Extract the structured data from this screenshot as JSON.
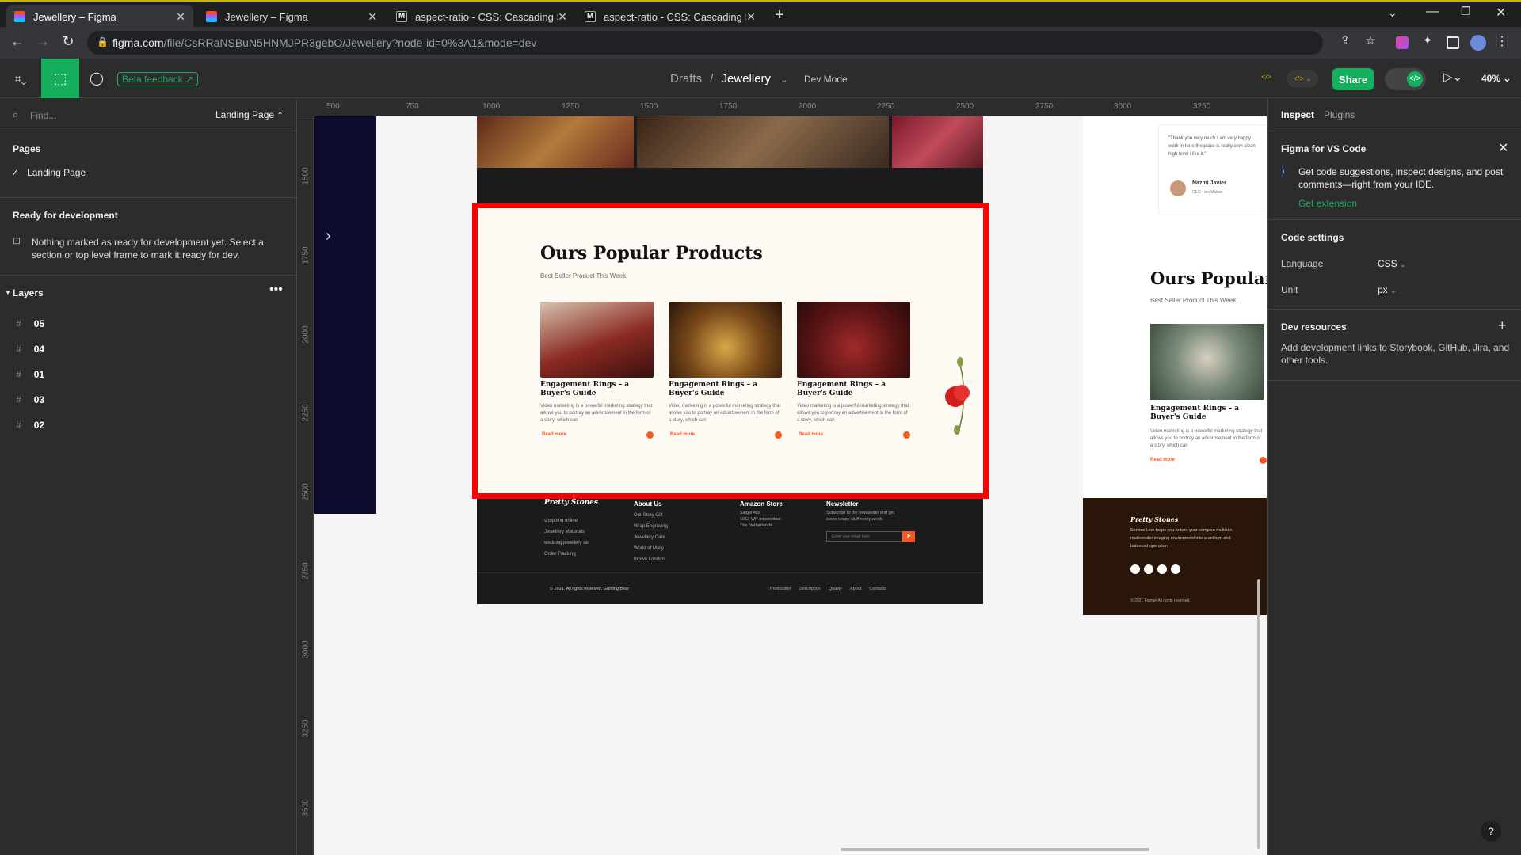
{
  "browser": {
    "tabs": [
      {
        "title": "Jewellery – Figma",
        "icon": "figma-icon"
      },
      {
        "title": "Jewellery – Figma",
        "icon": "figma-icon"
      },
      {
        "title": "aspect-ratio - CSS: Cascading St",
        "icon": "mdn-icon"
      },
      {
        "title": "aspect-ratio - CSS: Cascading St",
        "icon": "mdn-icon"
      }
    ],
    "url_host": "figma.com",
    "url_path": "/file/CsRRaNSBuN5HNMJPR3gebO/Jewellery?node-id=0%3A1&mode=dev"
  },
  "toolbar": {
    "beta_feedback": "Beta feedback",
    "breadcrumb_root": "Drafts",
    "breadcrumb_sep": "/",
    "file_name": "Jewellery",
    "dev_mode": "Dev Mode",
    "share": "Share",
    "zoom": "40%"
  },
  "left_panel": {
    "search_placeholder": "Find...",
    "page_selector": "Landing Page",
    "pages_heading": "Pages",
    "pages": [
      "Landing Page"
    ],
    "ready_heading": "Ready for development",
    "ready_text": "Nothing marked as ready for development yet. Select a section or top level frame to mark it ready for dev.",
    "layers_heading": "Layers",
    "layers": [
      "05",
      "04",
      "01",
      "03",
      "02"
    ]
  },
  "rulers": {
    "top": [
      "500",
      "750",
      "1000",
      "1250",
      "1500",
      "1750",
      "2000",
      "2250",
      "2500",
      "2750",
      "3000",
      "3250"
    ],
    "left": [
      "1500",
      "1750",
      "2000",
      "2250",
      "2500",
      "2750",
      "3000",
      "3250",
      "3500"
    ]
  },
  "design": {
    "section_title": "Ours Popular Products",
    "section_subtitle": "Best Seller Product This Week!",
    "cards": [
      {
        "title": "Engagement Rings – a Buyer's Guide",
        "desc": "Video marketing is a powerful marketing strategy that allows you to portray an advertisement in the form of a story, which can",
        "more": "Read more"
      },
      {
        "title": "Engagement Rings – a Buyer's Guide",
        "desc": "Video marketing is a powerful marketing strategy that allows you to portray an advertisement in the form of a story, which can",
        "more": "Read more"
      },
      {
        "title": "Engagement Rings – a Buyer's Guide",
        "desc": "Video marketing is a powerful marketing strategy that allows you to portray an advertisement in the form of a story, which can",
        "more": "Read more"
      }
    ],
    "footer": {
      "brand": "Pretty Stones",
      "brand_links": [
        "shopping online",
        "Jewellery Materials",
        "wedding jewellery set",
        "Order Tracking"
      ],
      "about_heading": "About Us",
      "about_links": [
        "Our Story Gift",
        "Wrap Engraving",
        "Jewellery Care",
        "World of Molly",
        "Brown London"
      ],
      "store_heading": "Amazon Store",
      "store_lines": [
        "Singel 459",
        "1012 WP Amsterdam",
        "The Netherlands"
      ],
      "newsletter_heading": "Newsletter",
      "newsletter_text": "Subscribe to the newsletter and get some crispy stuff every week.",
      "email_placeholder": "Enter your email here",
      "copyright": "© 2021. All rights reserved. Gaming Bear",
      "bottom_links": [
        "Production",
        "Description",
        "Quality",
        "About",
        "Contacts"
      ]
    },
    "mobile": {
      "quote": "\"Thank you very much I am very happy work in here the place is really com clean high level i like it.\"",
      "author": "Nazmi Javier",
      "author_role": "CEO - Inc Mabar",
      "section_title": "Ours Popular F",
      "section_subtitle": "Best Seller Product This Week!",
      "card_title": "Engagement Rings – a Buyer's Guide",
      "card_desc": "Video marketing is a powerful marketing strategy that allows you to portray an advertisement in the form of a story, which can",
      "card_more": "Read more",
      "footer_brand": "Pretty Stones",
      "footer_text": "Service Line helps you to turn your complex multisite, multivendor imaging environment into a uniform and balanced operation.",
      "footer_copy": "© 2021 Fiama• All rights reserved."
    }
  },
  "right_panel": {
    "tabs": [
      "Inspect",
      "Plugins"
    ],
    "vscode_heading": "Figma for VS Code",
    "vscode_text": "Get code suggestions, inspect designs, and post comments—right from your IDE.",
    "vscode_link": "Get extension",
    "code_settings_heading": "Code settings",
    "language_label": "Language",
    "language_value": "CSS",
    "unit_label": "Unit",
    "unit_value": "px",
    "dev_resources_heading": "Dev resources",
    "dev_resources_text": "Add development links to Storybook, GitHub, Jira, and other tools."
  },
  "colors": {
    "accent_green": "#14ae5c",
    "selection_red": "#ff0000",
    "brand_orange": "#f15a24"
  }
}
